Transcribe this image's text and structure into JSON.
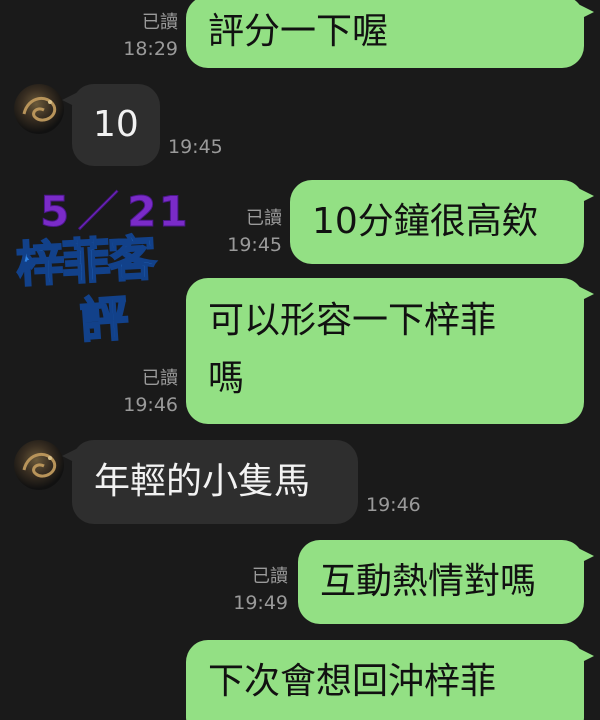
{
  "colors": {
    "background": "#1a1a1a",
    "outgoing_bubble": "#93e084",
    "incoming_bubble": "#2e2e2e",
    "meta_text": "#9a9a9a"
  },
  "messages": [
    {
      "direction": "out",
      "text": "評分一下喔",
      "read": "已讀",
      "time": "18:29"
    },
    {
      "direction": "in",
      "text": "10",
      "time": "19:45"
    },
    {
      "direction": "out",
      "text": "10分鐘很高欸",
      "read": "已讀",
      "time": "19:45"
    },
    {
      "direction": "out",
      "text_line1": "可以形容一下梓菲",
      "text_line2": "嗎",
      "read": "已讀",
      "time": "19:46"
    },
    {
      "direction": "in",
      "text": "年輕的小隻馬",
      "time": "19:46"
    },
    {
      "direction": "out",
      "text": "互動熱情對嗎",
      "read": "已讀",
      "time": "19:49"
    },
    {
      "direction": "out",
      "text": "下次會想回沖梓菲"
    }
  ],
  "sticker": {
    "date_month": "5",
    "date_slash": "／",
    "date_day": "21",
    "title": "梓菲客",
    "subtitle": "評"
  },
  "avatar_icon": "dragon-avatar-icon"
}
